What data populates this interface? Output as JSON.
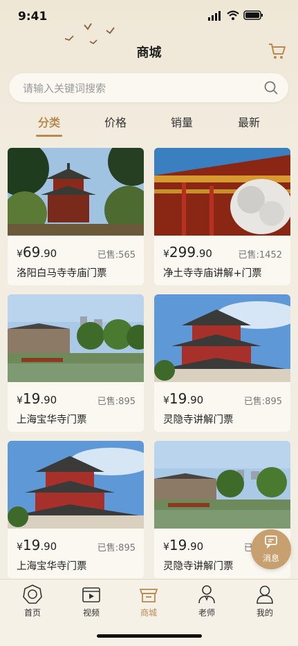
{
  "status": {
    "time": "9:41"
  },
  "header": {
    "title": "商城"
  },
  "search": {
    "placeholder": "请输入关键词搜索"
  },
  "tabs": [
    {
      "label": "分类",
      "active": true
    },
    {
      "label": "价格"
    },
    {
      "label": "销量"
    },
    {
      "label": "最新"
    }
  ],
  "products": [
    {
      "yen": "¥",
      "price_int": "69",
      "price_dec": ".90",
      "sold": "已售:565",
      "name": "洛阳白马寺寺庙门票"
    },
    {
      "yen": "¥",
      "price_int": "299",
      "price_dec": ".90",
      "sold": "已售:1452",
      "name": "净土寺寺庙讲解+门票"
    },
    {
      "yen": "¥",
      "price_int": "19",
      "price_dec": ".90",
      "sold": "已售:895",
      "name": "上海宝华寺门票"
    },
    {
      "yen": "¥",
      "price_int": "19",
      "price_dec": ".90",
      "sold": "已售:895",
      "name": "灵隐寺讲解门票"
    },
    {
      "yen": "¥",
      "price_int": "19",
      "price_dec": ".90",
      "sold": "已售:895",
      "name": "上海宝华寺门票"
    },
    {
      "yen": "¥",
      "price_int": "19",
      "price_dec": ".90",
      "sold": "已售:895",
      "name": "灵隐寺讲解门票"
    }
  ],
  "floating": {
    "message_label": "消息"
  },
  "nav": [
    {
      "label": "首页",
      "icon": "home-icon"
    },
    {
      "label": "视频",
      "icon": "video-icon"
    },
    {
      "label": "商城",
      "icon": "shop-icon",
      "active": true
    },
    {
      "label": "老师",
      "icon": "teacher-icon"
    },
    {
      "label": "我的",
      "icon": "profile-icon"
    }
  ],
  "colors": {
    "accent": "#b98a4f",
    "background": "#f2ece0"
  }
}
